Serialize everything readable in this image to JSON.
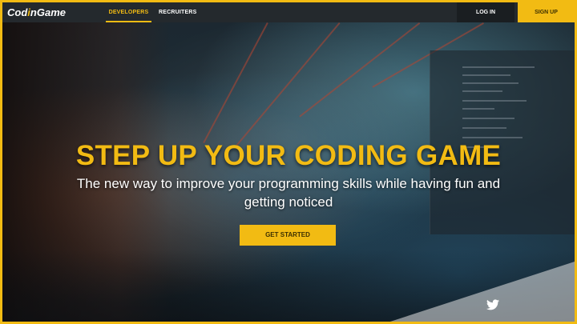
{
  "brand": {
    "logo_main": "Cod",
    "logo_accent": "i",
    "logo_rest": "nGame"
  },
  "navbar": {
    "links": [
      {
        "label": "DEVELOPERS",
        "active": true
      },
      {
        "label": "RECRUITERS",
        "active": false
      }
    ],
    "login_label": "LOG IN",
    "signup_label": "SIGN UP"
  },
  "hero": {
    "headline": "STEP UP YOUR CODING GAME",
    "subtitle": "The new way to improve your programming skills while having fun and getting noticed",
    "cta_label": "GET STARTED"
  },
  "social": {
    "icon": "twitter-icon"
  },
  "colors": {
    "accent": "#f2bb13",
    "navbar_bg": "#24292d",
    "login_bg": "#1a1e21"
  }
}
